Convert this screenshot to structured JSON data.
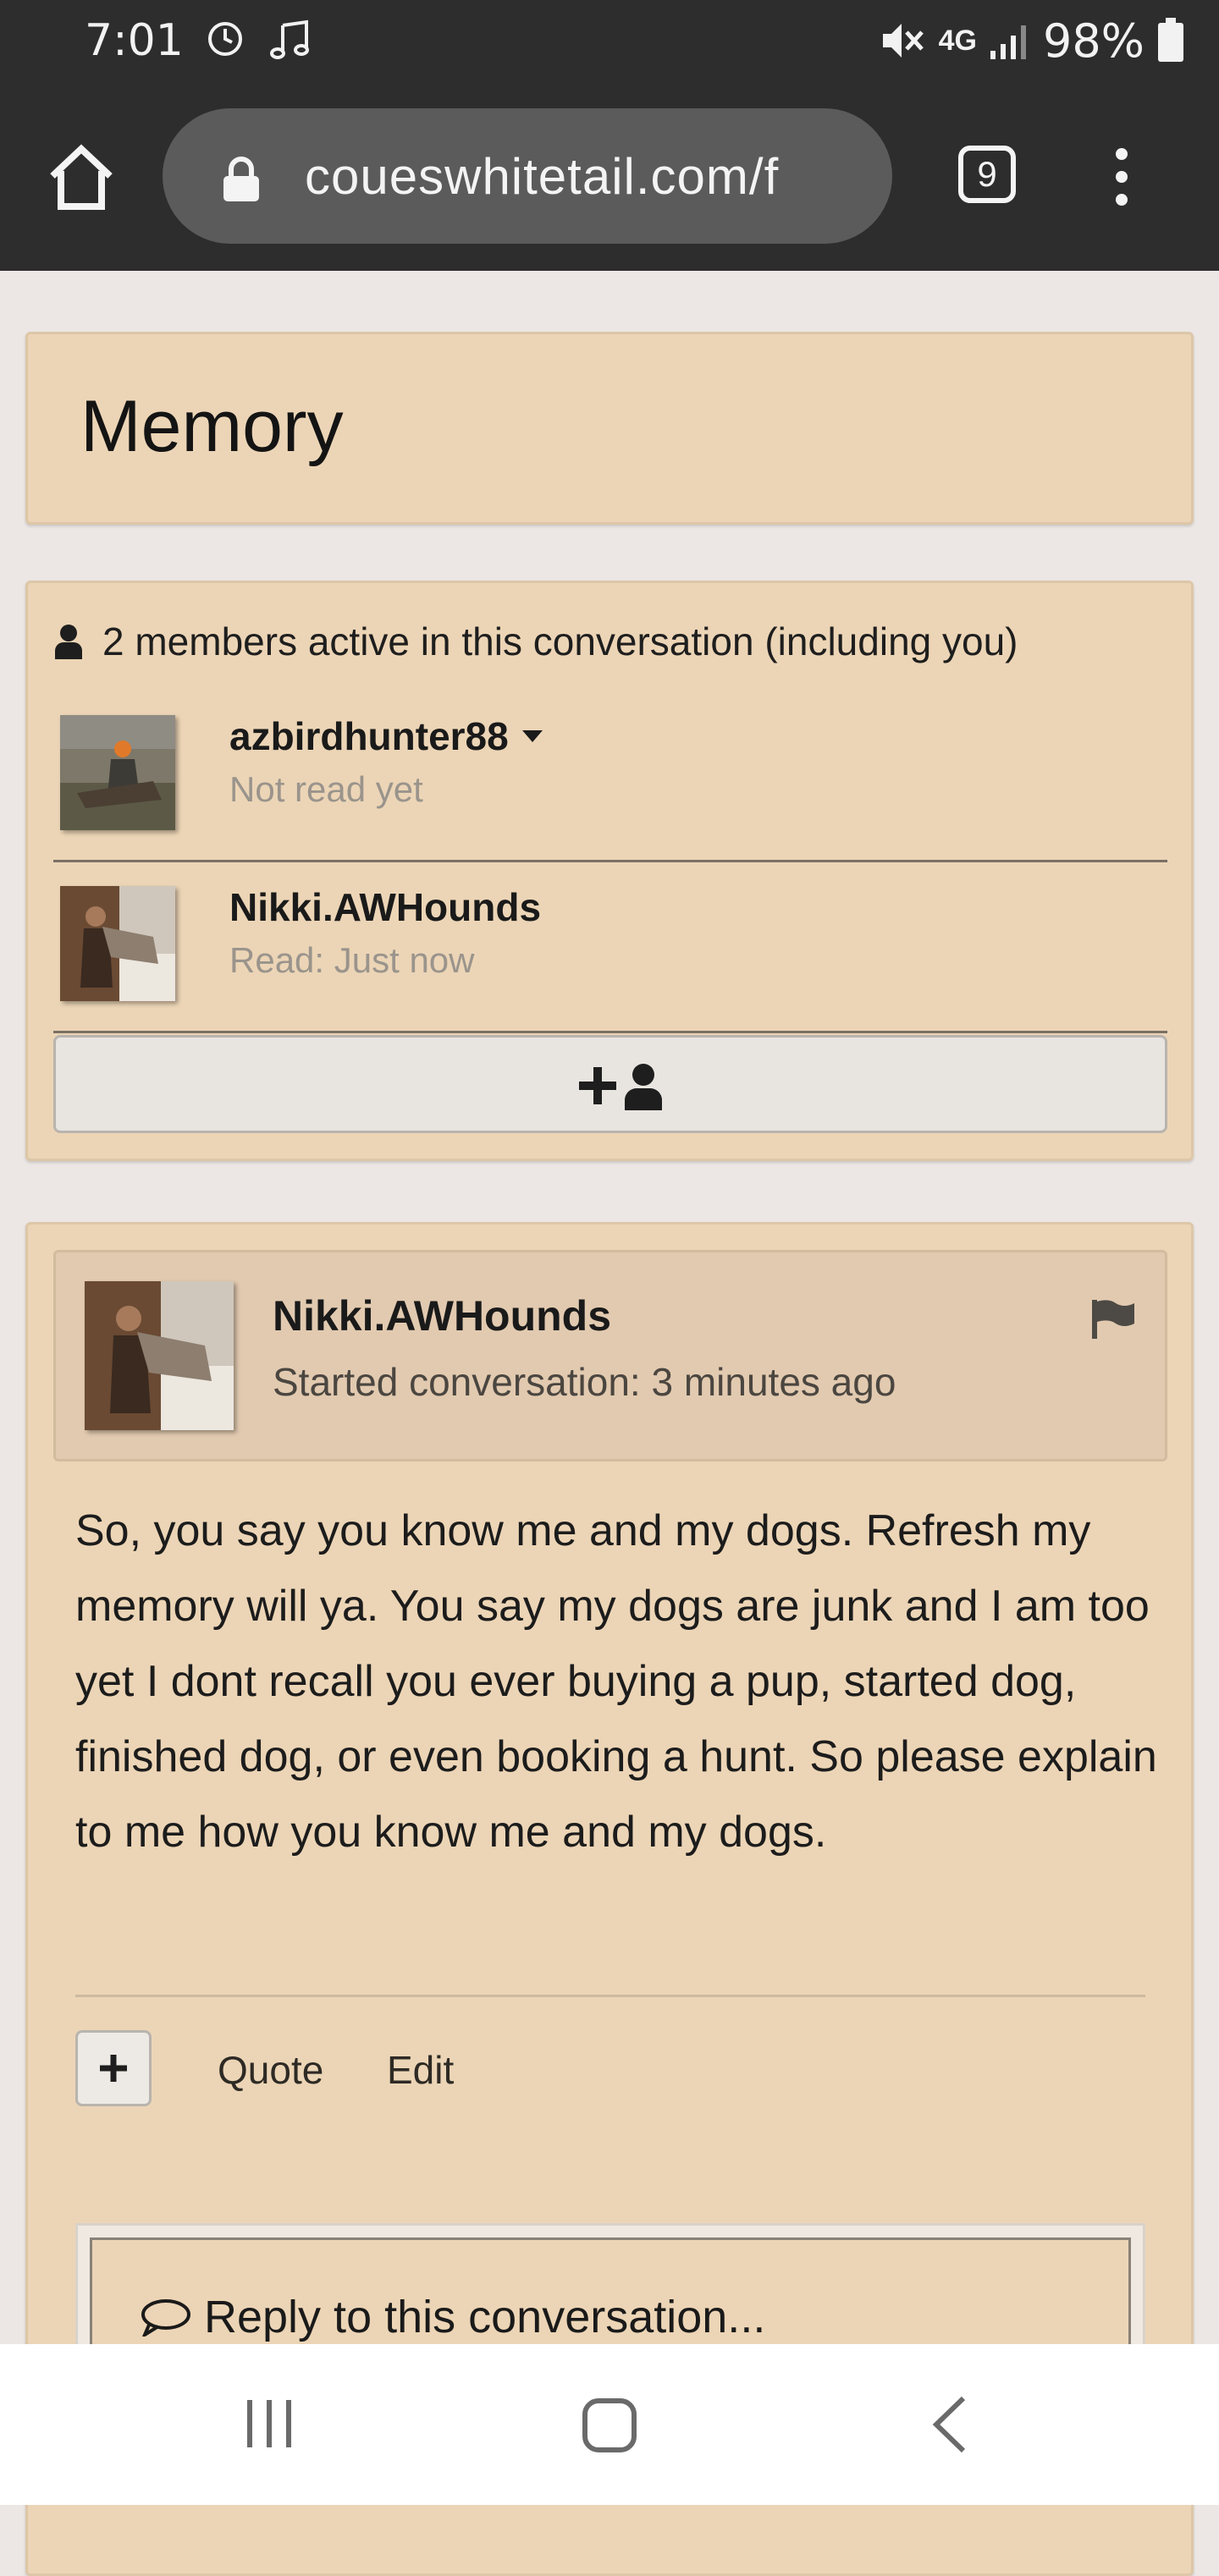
{
  "status_bar": {
    "time": "7:01",
    "network": "4G",
    "battery": "98%"
  },
  "browser": {
    "url": "coueswhitetail.com/f",
    "tab_count": "9"
  },
  "page": {
    "title": "Memory"
  },
  "members": {
    "header": "2 members active in this conversation (including you)",
    "list": [
      {
        "name": "azbirdhunter88",
        "status": "Not read yet"
      },
      {
        "name": "Nikki.AWHounds",
        "status": "Read: Just now"
      }
    ]
  },
  "message": {
    "author": "Nikki.AWHounds",
    "started": "Started conversation: 3 minutes ago",
    "body": "So, you say you know me and my dogs. Refresh my memory will ya. You say my dogs are junk and I am too yet I dont recall you ever buying a pup, started dog, finished dog, or even booking a hunt. So please explain to me how you know me and my dogs.",
    "actions": {
      "quote": "Quote",
      "edit": "Edit"
    },
    "reply_placeholder": "Reply to this conversation..."
  },
  "colors": {
    "panel_bg": "#ecd5b6",
    "header_bg": "#2d2d2d",
    "page_bg": "#ece7e5"
  }
}
